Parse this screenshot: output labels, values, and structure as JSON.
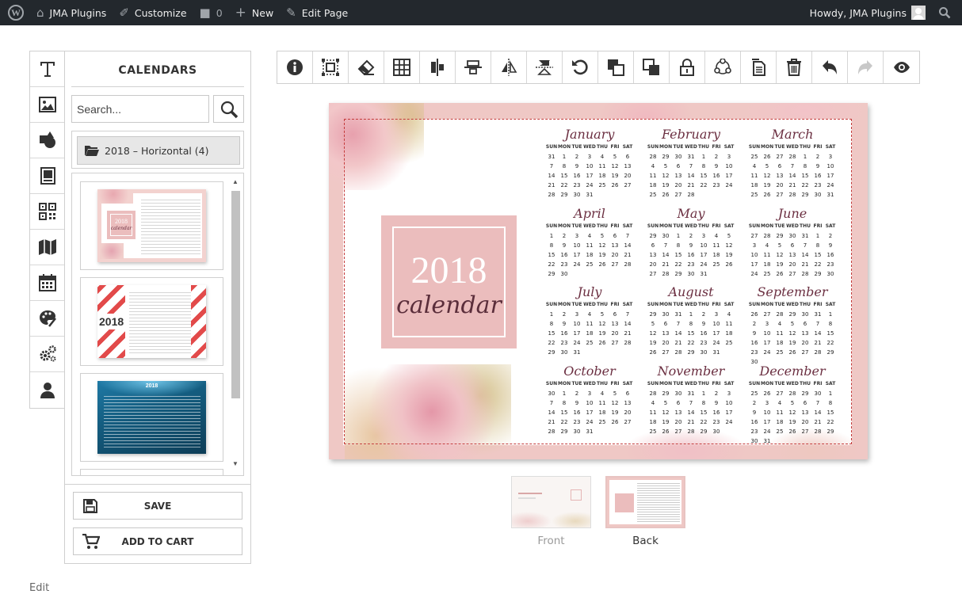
{
  "adminbar": {
    "site_name": "JMA Plugins",
    "customize": "Customize",
    "comments_count": "0",
    "new_label": "New",
    "edit_page": "Edit Page",
    "howdy": "Howdy, JMA Plugins"
  },
  "tools": [
    "text-icon",
    "image-icon",
    "shapes-icon",
    "photo-book-icon",
    "qrcode-icon",
    "map-icon",
    "calendar-icon",
    "palette-icon",
    "cogs-icon",
    "user-icon"
  ],
  "panel": {
    "title": "CALENDARS",
    "search_placeholder": "Search...",
    "folder": "2018 – Horizontal (4)",
    "save": "SAVE",
    "add_to_cart": "ADD TO CART"
  },
  "thumb_texts": {
    "t1_year": "2018",
    "t1_word": "calendar",
    "t2_year": "2018"
  },
  "toolbar": [
    "info-icon",
    "select-area-icon",
    "eraser-icon",
    "grid-icon",
    "align-center-icon",
    "align-middle-icon",
    "flip-horizontal-icon",
    "flip-vertical-icon",
    "rotate-icon",
    "bring-forward-icon",
    "send-backward-icon",
    "lock-icon",
    "group-icon",
    "duplicate-icon",
    "delete-icon",
    "undo-icon",
    "redo-icon",
    "preview-icon"
  ],
  "calendar": {
    "year": "2018",
    "word": "calendar",
    "weekdays": [
      "SUN",
      "MON",
      "TUE",
      "WED",
      "THU",
      "FRI",
      "SAT"
    ],
    "months": [
      {
        "name": "January",
        "weeks": [
          [
            "31",
            "1",
            "2",
            "3",
            "4",
            "5",
            "6"
          ],
          [
            "7",
            "8",
            "9",
            "10",
            "11",
            "12",
            "13"
          ],
          [
            "14",
            "15",
            "16",
            "17",
            "18",
            "19",
            "20"
          ],
          [
            "21",
            "22",
            "23",
            "24",
            "25",
            "26",
            "27"
          ],
          [
            "28",
            "29",
            "30",
            "31",
            "",
            "",
            ""
          ]
        ]
      },
      {
        "name": "February",
        "weeks": [
          [
            "28",
            "29",
            "30",
            "31",
            "1",
            "2",
            "3"
          ],
          [
            "4",
            "5",
            "6",
            "7",
            "8",
            "9",
            "10"
          ],
          [
            "11",
            "12",
            "13",
            "14",
            "15",
            "16",
            "17"
          ],
          [
            "18",
            "19",
            "20",
            "21",
            "22",
            "23",
            "24"
          ],
          [
            "25",
            "26",
            "27",
            "28",
            "",
            "",
            ""
          ]
        ]
      },
      {
        "name": "March",
        "weeks": [
          [
            "25",
            "26",
            "27",
            "28",
            "1",
            "2",
            "3"
          ],
          [
            "4",
            "5",
            "6",
            "7",
            "8",
            "9",
            "10"
          ],
          [
            "11",
            "12",
            "13",
            "14",
            "15",
            "16",
            "17"
          ],
          [
            "18",
            "19",
            "20",
            "21",
            "22",
            "23",
            "24"
          ],
          [
            "25",
            "26",
            "27",
            "28",
            "29",
            "30",
            "31"
          ]
        ]
      },
      {
        "name": "April",
        "weeks": [
          [
            "1",
            "2",
            "3",
            "4",
            "5",
            "6",
            "7"
          ],
          [
            "8",
            "9",
            "10",
            "11",
            "12",
            "13",
            "14"
          ],
          [
            "15",
            "16",
            "17",
            "18",
            "19",
            "20",
            "21"
          ],
          [
            "22",
            "23",
            "24",
            "25",
            "26",
            "27",
            "28"
          ],
          [
            "29",
            "30",
            "",
            "",
            "",
            "",
            ""
          ]
        ]
      },
      {
        "name": "May",
        "weeks": [
          [
            "29",
            "30",
            "1",
            "2",
            "3",
            "4",
            "5"
          ],
          [
            "6",
            "7",
            "8",
            "9",
            "10",
            "11",
            "12"
          ],
          [
            "13",
            "14",
            "15",
            "16",
            "17",
            "18",
            "19"
          ],
          [
            "20",
            "21",
            "22",
            "23",
            "24",
            "25",
            "26"
          ],
          [
            "27",
            "28",
            "29",
            "30",
            "31",
            "",
            ""
          ]
        ]
      },
      {
        "name": "June",
        "weeks": [
          [
            "27",
            "28",
            "29",
            "30",
            "31",
            "1",
            "2"
          ],
          [
            "3",
            "4",
            "5",
            "6",
            "7",
            "8",
            "9"
          ],
          [
            "10",
            "11",
            "12",
            "13",
            "14",
            "15",
            "16"
          ],
          [
            "17",
            "18",
            "19",
            "20",
            "21",
            "22",
            "23"
          ],
          [
            "24",
            "25",
            "26",
            "27",
            "28",
            "29",
            "30"
          ]
        ]
      },
      {
        "name": "July",
        "weeks": [
          [
            "1",
            "2",
            "3",
            "4",
            "5",
            "6",
            "7"
          ],
          [
            "8",
            "9",
            "10",
            "11",
            "12",
            "13",
            "14"
          ],
          [
            "15",
            "16",
            "17",
            "18",
            "19",
            "20",
            "21"
          ],
          [
            "22",
            "23",
            "24",
            "25",
            "26",
            "27",
            "28"
          ],
          [
            "29",
            "30",
            "31",
            "",
            "",
            "",
            ""
          ]
        ]
      },
      {
        "name": "August",
        "weeks": [
          [
            "29",
            "30",
            "31",
            "1",
            "2",
            "3",
            "4"
          ],
          [
            "5",
            "6",
            "7",
            "8",
            "9",
            "10",
            "11"
          ],
          [
            "12",
            "13",
            "14",
            "15",
            "16",
            "17",
            "18"
          ],
          [
            "19",
            "20",
            "21",
            "22",
            "23",
            "24",
            "25"
          ],
          [
            "26",
            "27",
            "28",
            "29",
            "30",
            "31",
            ""
          ]
        ]
      },
      {
        "name": "September",
        "weeks": [
          [
            "26",
            "27",
            "28",
            "29",
            "30",
            "31",
            "1"
          ],
          [
            "2",
            "3",
            "4",
            "5",
            "6",
            "7",
            "8"
          ],
          [
            "9",
            "10",
            "11",
            "12",
            "13",
            "14",
            "15"
          ],
          [
            "16",
            "17",
            "18",
            "19",
            "20",
            "21",
            "22"
          ],
          [
            "23",
            "24",
            "25",
            "26",
            "27",
            "28",
            "29"
          ],
          [
            "30",
            "",
            "",
            "",
            "",
            "",
            ""
          ]
        ]
      },
      {
        "name": "October",
        "weeks": [
          [
            "30",
            "1",
            "2",
            "3",
            "4",
            "5",
            "6"
          ],
          [
            "7",
            "8",
            "9",
            "10",
            "11",
            "12",
            "13"
          ],
          [
            "14",
            "15",
            "16",
            "17",
            "18",
            "19",
            "20"
          ],
          [
            "21",
            "22",
            "23",
            "24",
            "25",
            "26",
            "27"
          ],
          [
            "28",
            "29",
            "30",
            "31",
            "",
            "",
            ""
          ]
        ]
      },
      {
        "name": "November",
        "weeks": [
          [
            "28",
            "29",
            "30",
            "31",
            "1",
            "2",
            "3"
          ],
          [
            "4",
            "5",
            "6",
            "7",
            "8",
            "9",
            "10"
          ],
          [
            "11",
            "12",
            "13",
            "14",
            "15",
            "16",
            "17"
          ],
          [
            "18",
            "19",
            "20",
            "21",
            "22",
            "23",
            "24"
          ],
          [
            "25",
            "26",
            "27",
            "28",
            "29",
            "30",
            ""
          ]
        ]
      },
      {
        "name": "December",
        "weeks": [
          [
            "25",
            "26",
            "27",
            "28",
            "29",
            "30",
            "1"
          ],
          [
            "2",
            "3",
            "4",
            "5",
            "6",
            "7",
            "8"
          ],
          [
            "9",
            "10",
            "11",
            "12",
            "13",
            "14",
            "15"
          ],
          [
            "16",
            "17",
            "18",
            "19",
            "20",
            "21",
            "22"
          ],
          [
            "23",
            "24",
            "25",
            "26",
            "27",
            "28",
            "29"
          ],
          [
            "30",
            "31",
            "",
            "",
            "",
            "",
            ""
          ]
        ]
      }
    ]
  },
  "pages": {
    "front": "Front",
    "back": "Back"
  },
  "footer": {
    "edit": "Edit"
  },
  "colors": {
    "adminbar_bg": "#23282d",
    "canvas_pink": "#efc8c5",
    "month_title": "#6b2f41",
    "dashed_border": "#c43a3a"
  }
}
